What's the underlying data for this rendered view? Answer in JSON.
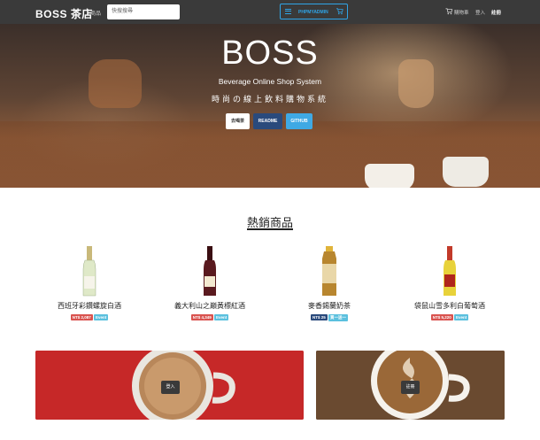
{
  "navbar": {
    "brand": "BOSS 茶店",
    "products_label": "商品",
    "search_placeholder": "快搜搜尋",
    "admin_label": "PHPMYADMIN",
    "cart_label": "購物車",
    "login_label": "登入",
    "register_label": "註冊"
  },
  "hero": {
    "title": "BOSS",
    "subtitle": "Beverage Online Shop System",
    "tagline": "時尚の線上飲料購物系統",
    "buttons": [
      "去喝茶",
      "README",
      "GITHUB"
    ]
  },
  "hot_products": {
    "title": "熱銷商品",
    "items": [
      {
        "name": "西班牙彩鑽螺旋白酒",
        "price": "NT$ 2,087",
        "badge": "Event",
        "bottle_color": "#dfe9c8"
      },
      {
        "name": "義大利山之巔黃標紅酒",
        "price": "NT$ 4,349",
        "badge": "Event",
        "bottle_color": "#5a1a1f"
      },
      {
        "name": "麥香錫蘭奶茶",
        "price": "NT$ 25",
        "badge": "買一送一",
        "bottle_color": "#b8862f"
      },
      {
        "name": "袋鼠山雪多利白葡萄酒",
        "price": "NT$ 5,220",
        "badge": "Event",
        "bottle_color": "#e8d23a"
      }
    ]
  },
  "cards": {
    "login_label": "登入",
    "register_label": "註冊"
  },
  "colors": {
    "navbar": "#3a3a3a",
    "accent": "#2fa4e7",
    "price_tag": "#d9534f",
    "event_tag": "#5bc0de"
  }
}
